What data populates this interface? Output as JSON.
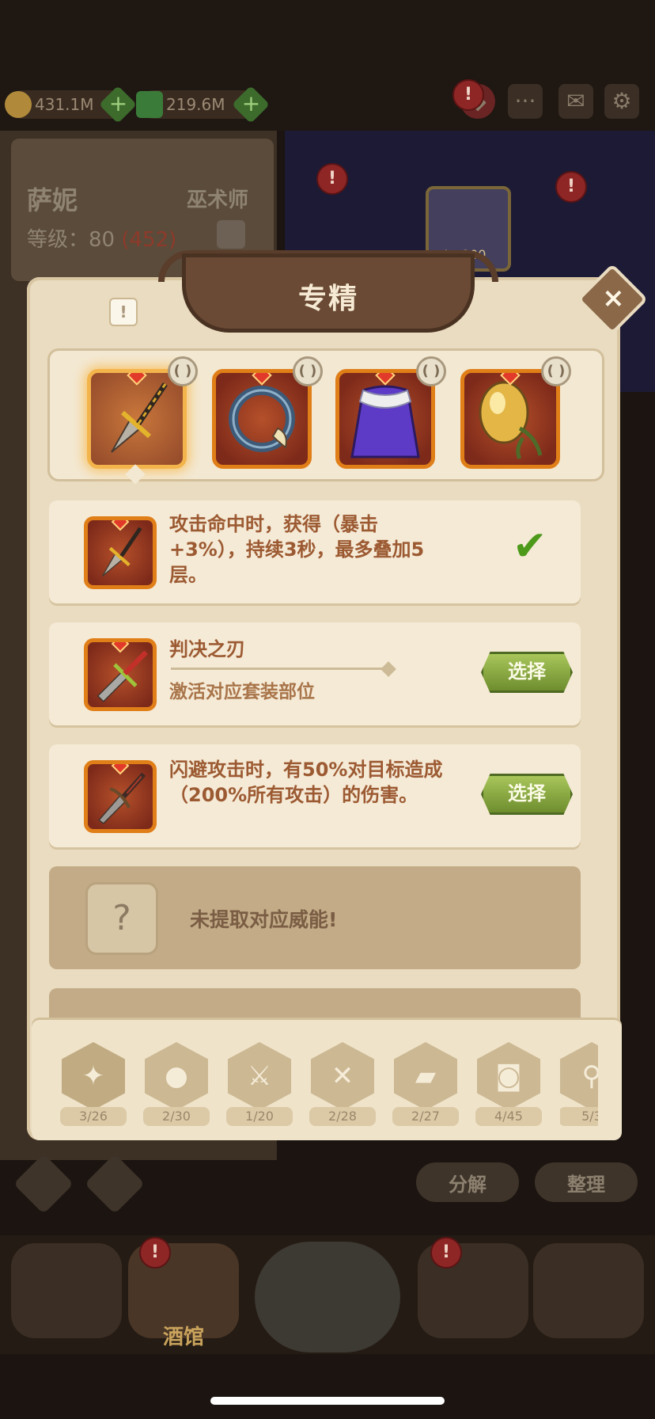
{
  "resources": [
    {
      "icon": "gold-coin-icon",
      "amount": "431.1M",
      "add_label": "+"
    },
    {
      "icon": "green-gem-icon",
      "amount": "219.6M",
      "add_label": "+"
    }
  ],
  "top_icons": [
    "bag-icon",
    "chat-icon",
    "mail-icon",
    "settings-gear-icon"
  ],
  "hero": {
    "name": "萨妮",
    "class": "巫术师",
    "level_label": "等级：80",
    "level_extra": "(452)"
  },
  "scene": {
    "level_badge": "Lv.200"
  },
  "alert_mark": "!",
  "modal": {
    "title": "专精",
    "close_label": "×",
    "info_label": "!",
    "items": [
      {
        "name": "dagger",
        "icon": "golden-dagger-icon",
        "selected": true
      },
      {
        "name": "ring",
        "icon": "blue-ring-icon",
        "selected": false
      },
      {
        "name": "cloak",
        "icon": "purple-cloak-icon",
        "selected": false
      },
      {
        "name": "seed",
        "icon": "golden-seed-icon",
        "selected": false
      }
    ],
    "options": [
      {
        "text": "攻击命中时，获得（暴击+3%），持续3秒，最多叠加5层。",
        "icon": "golden-dagger-icon",
        "status": "chosen"
      },
      {
        "title": "判决之刃",
        "text": "激活对应套装部位",
        "icon": "red-sword-icon",
        "button": "选择"
      },
      {
        "text": "闪避攻击时，有50%对目标造成（200%所有攻击）的伤害。",
        "icon": "dark-dagger-icon",
        "button": "选择"
      },
      {
        "text": "未提取对应威能!",
        "icon": "question-icon",
        "locked": true
      }
    ],
    "categories": [
      {
        "icon": "leg-icon",
        "count": "3/26"
      },
      {
        "icon": "drumstick-icon",
        "count": "2/30"
      },
      {
        "icon": "sword-icon",
        "count": "1/20"
      },
      {
        "icon": "shield-icon",
        "count": "2/28"
      },
      {
        "icon": "book-icon",
        "count": "2/27"
      },
      {
        "icon": "helmet-icon",
        "count": "4/45"
      },
      {
        "icon": "magnifier-icon",
        "count": "5/3"
      }
    ]
  },
  "bottom_buttons": {
    "decompose": "分解",
    "arrange": "整理"
  },
  "bottom_nav": {
    "tavern": "酒馆"
  }
}
